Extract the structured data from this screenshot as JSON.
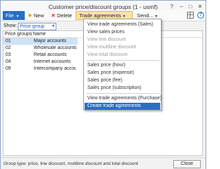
{
  "window": {
    "title": "Customer price/discount groups (1 - usmf)"
  },
  "window_controls": {
    "help": "?",
    "minimize": "–",
    "maximize": "□",
    "close": "✕"
  },
  "toolbar": {
    "file_label": "File",
    "new_label": "New",
    "delete_label": "Delete",
    "trade_agreements_label": "Trade agreements",
    "send_label": "Send...",
    "help_icon_glyph": "?"
  },
  "filter": {
    "show_label": "Show:",
    "show_value": "Price group"
  },
  "grid": {
    "columns": [
      "Price groups",
      "Name"
    ],
    "rows": [
      {
        "group": "01",
        "name": "Major accounts",
        "selected": true
      },
      {
        "group": "02",
        "name": "Wholesale accounts"
      },
      {
        "group": "03",
        "name": "Retail accounts"
      },
      {
        "group": "04",
        "name": "Internet accounts"
      },
      {
        "group": "09",
        "name": "Intercompany accou..."
      }
    ]
  },
  "trade_menu": {
    "items": [
      {
        "label": "View trade agreements (Sales)",
        "state": "enabled"
      },
      {
        "label": "View sales prices",
        "state": "enabled"
      },
      {
        "label": "View line discount",
        "state": "disabled"
      },
      {
        "label": "View multiline discount",
        "state": "disabled"
      },
      {
        "label": "View total discount",
        "state": "disabled"
      },
      {
        "label": "Sales price (hour)",
        "state": "enabled"
      },
      {
        "label": "Sales price (expense)",
        "state": "enabled"
      },
      {
        "label": "Sales price (fee)",
        "state": "enabled"
      },
      {
        "label": "Sales price (subscription)",
        "state": "enabled"
      },
      {
        "label": "View trade agreements (Purchase)",
        "state": "enabled"
      },
      {
        "label": "Create trade agreements",
        "state": "highlighted"
      }
    ]
  },
  "status": {
    "text": "Group type: price, line discount, multiline discount and total discount",
    "close_label": "Close"
  },
  "colors": {
    "accent": "#2a6ec3",
    "trade_button_bg": "#fbe3a4",
    "selected_row": "#cfe3f7"
  }
}
